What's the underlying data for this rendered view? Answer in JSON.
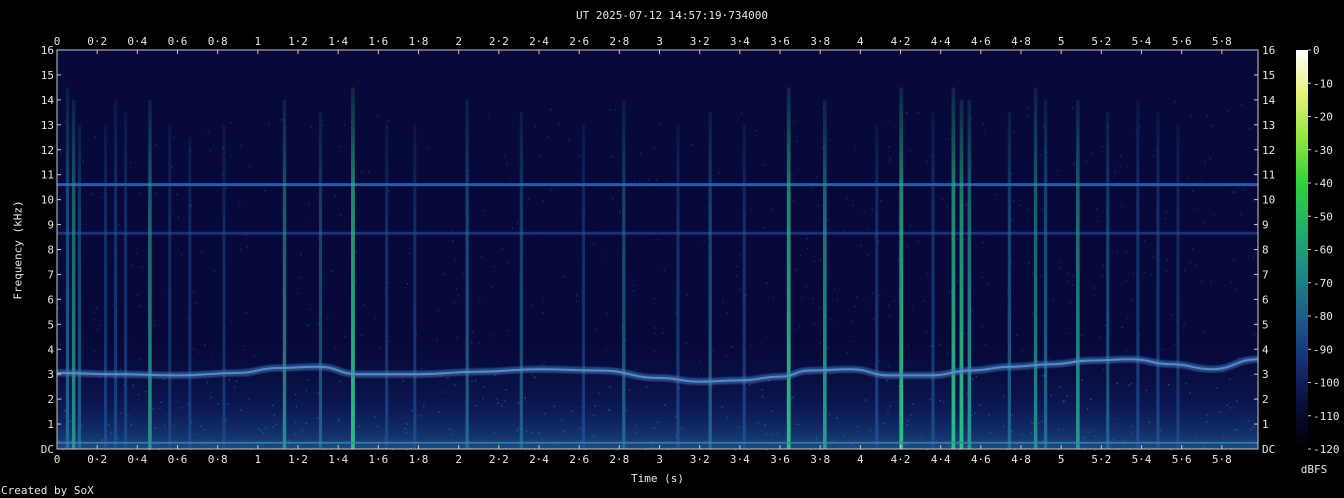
{
  "chart_data": {
    "type": "heatmap",
    "title": "UT 2025-07-12 14:57:19·734000",
    "xlabel": "Time (s)",
    "ylabel": "Frequency (kHz)",
    "xlim": [
      0,
      5.98
    ],
    "ylim": [
      0,
      16
    ],
    "x_ticks": [
      "0",
      "0·2",
      "0·4",
      "0·6",
      "0·8",
      "1",
      "1·2",
      "1·4",
      "1·6",
      "1·8",
      "2",
      "2·2",
      "2·4",
      "2·6",
      "2·8",
      "3",
      "3·2",
      "3·4",
      "3·6",
      "3·8",
      "4",
      "4·2",
      "4·4",
      "4·6",
      "4·8",
      "5",
      "5·2",
      "5·4",
      "5·6",
      "5·8"
    ],
    "y_ticks": [
      "DC",
      "1",
      "2",
      "3",
      "4",
      "5",
      "6",
      "7",
      "8",
      "9",
      "10",
      "11",
      "12",
      "13",
      "14",
      "15",
      "16"
    ],
    "colorbar": {
      "label": "dBFS",
      "ticks": [
        "0",
        "-10",
        "-20",
        "-30",
        "-40",
        "-50",
        "-60",
        "-70",
        "-80",
        "-90",
        "-100",
        "-110",
        "-120"
      ],
      "range": [
        -120,
        0
      ]
    },
    "tones_khz": [
      10.6,
      8.65
    ],
    "sweep_curve": {
      "t": [
        0,
        0.3,
        0.6,
        0.9,
        1.1,
        1.3,
        1.5,
        1.8,
        2.1,
        2.4,
        2.7,
        3.0,
        3.2,
        3.4,
        3.6,
        3.75,
        3.95,
        4.15,
        4.35,
        4.55,
        4.75,
        4.95,
        5.15,
        5.35,
        5.55,
        5.75,
        5.98
      ],
      "khz": [
        3.05,
        3.0,
        2.95,
        3.05,
        3.25,
        3.3,
        3.0,
        3.0,
        3.1,
        3.2,
        3.15,
        2.85,
        2.7,
        2.75,
        2.9,
        3.15,
        3.2,
        2.95,
        2.95,
        3.15,
        3.3,
        3.4,
        3.55,
        3.6,
        3.4,
        3.2,
        3.6
      ]
    },
    "impulses": [
      {
        "t": 0.05,
        "top": 14.5,
        "level": 0.6
      },
      {
        "t": 0.08,
        "top": 14.0,
        "level": 0.7
      },
      {
        "t": 0.11,
        "top": 13.0,
        "level": 0.5
      },
      {
        "t": 0.24,
        "top": 13.0,
        "level": 0.4
      },
      {
        "t": 0.29,
        "top": 14.0,
        "level": 0.45
      },
      {
        "t": 0.34,
        "top": 13.5,
        "level": 0.4
      },
      {
        "t": 0.46,
        "top": 14.0,
        "level": 0.7
      },
      {
        "t": 0.56,
        "top": 13.0,
        "level": 0.35
      },
      {
        "t": 0.66,
        "top": 12.5,
        "level": 0.35
      },
      {
        "t": 0.83,
        "top": 13.0,
        "level": 0.35
      },
      {
        "t": 1.13,
        "top": 14.0,
        "level": 0.65
      },
      {
        "t": 1.31,
        "top": 13.5,
        "level": 0.5
      },
      {
        "t": 1.47,
        "top": 14.5,
        "level": 0.9
      },
      {
        "t": 1.64,
        "top": 13.0,
        "level": 0.4
      },
      {
        "t": 1.78,
        "top": 13.0,
        "level": 0.4
      },
      {
        "t": 2.04,
        "top": 14.0,
        "level": 0.55
      },
      {
        "t": 2.31,
        "top": 13.5,
        "level": 0.5
      },
      {
        "t": 2.62,
        "top": 13.0,
        "level": 0.4
      },
      {
        "t": 2.82,
        "top": 14.0,
        "level": 0.55
      },
      {
        "t": 3.09,
        "top": 13.0,
        "level": 0.45
      },
      {
        "t": 3.25,
        "top": 13.5,
        "level": 0.55
      },
      {
        "t": 3.42,
        "top": 13.0,
        "level": 0.45
      },
      {
        "t": 3.64,
        "top": 14.5,
        "level": 0.85
      },
      {
        "t": 3.82,
        "top": 14.0,
        "level": 0.8
      },
      {
        "t": 4.08,
        "top": 13.0,
        "level": 0.45
      },
      {
        "t": 4.2,
        "top": 14.5,
        "level": 0.9
      },
      {
        "t": 4.36,
        "top": 13.5,
        "level": 0.45
      },
      {
        "t": 4.46,
        "top": 14.5,
        "level": 0.85
      },
      {
        "t": 4.5,
        "top": 14.0,
        "level": 0.85
      },
      {
        "t": 4.54,
        "top": 14.0,
        "level": 0.75
      },
      {
        "t": 4.74,
        "top": 13.5,
        "level": 0.55
      },
      {
        "t": 4.87,
        "top": 14.5,
        "level": 0.65
      },
      {
        "t": 4.92,
        "top": 14.0,
        "level": 0.6
      },
      {
        "t": 5.08,
        "top": 14.0,
        "level": 0.75
      },
      {
        "t": 5.23,
        "top": 13.5,
        "level": 0.5
      },
      {
        "t": 5.38,
        "top": 14.0,
        "level": 0.45
      },
      {
        "t": 5.48,
        "top": 13.5,
        "level": 0.45
      },
      {
        "t": 5.58,
        "top": 13.0,
        "level": 0.35
      }
    ],
    "credit": "Created by SoX",
    "grid": false,
    "colormap": [
      "#000000",
      "#0a0d3a",
      "#15307a",
      "#1b5e8c",
      "#1d8a85",
      "#22b06a",
      "#2dd33a",
      "#8fe63b",
      "#e8f07a",
      "#ffffff"
    ]
  }
}
